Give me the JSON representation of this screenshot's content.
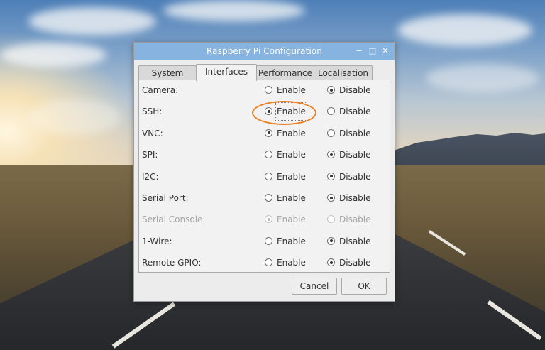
{
  "window": {
    "title": "Raspberry Pi Configuration",
    "controls": {
      "minimize": "−",
      "maximize": "□",
      "close": "✕"
    }
  },
  "tabs": [
    {
      "label": "System",
      "active": false
    },
    {
      "label": "Interfaces",
      "active": true
    },
    {
      "label": "Performance",
      "active": false
    },
    {
      "label": "Localisation",
      "active": false
    }
  ],
  "options": {
    "enable_label": "Enable",
    "disable_label": "Disable"
  },
  "interfaces": [
    {
      "label": "Camera:",
      "selected": "disable",
      "disabled": false
    },
    {
      "label": "SSH:",
      "selected": "enable",
      "disabled": false
    },
    {
      "label": "VNC:",
      "selected": "enable",
      "disabled": false
    },
    {
      "label": "SPI:",
      "selected": "disable",
      "disabled": false
    },
    {
      "label": "I2C:",
      "selected": "disable",
      "disabled": false
    },
    {
      "label": "Serial Port:",
      "selected": "disable",
      "disabled": false
    },
    {
      "label": "Serial Console:",
      "selected": "enable",
      "disabled": true
    },
    {
      "label": "1-Wire:",
      "selected": "disable",
      "disabled": false
    },
    {
      "label": "Remote GPIO:",
      "selected": "disable",
      "disabled": false
    }
  ],
  "buttons": {
    "cancel": "Cancel",
    "ok": "OK"
  },
  "colors": {
    "titlebar": "#87b3e0",
    "highlight": "#ee7f1f"
  }
}
